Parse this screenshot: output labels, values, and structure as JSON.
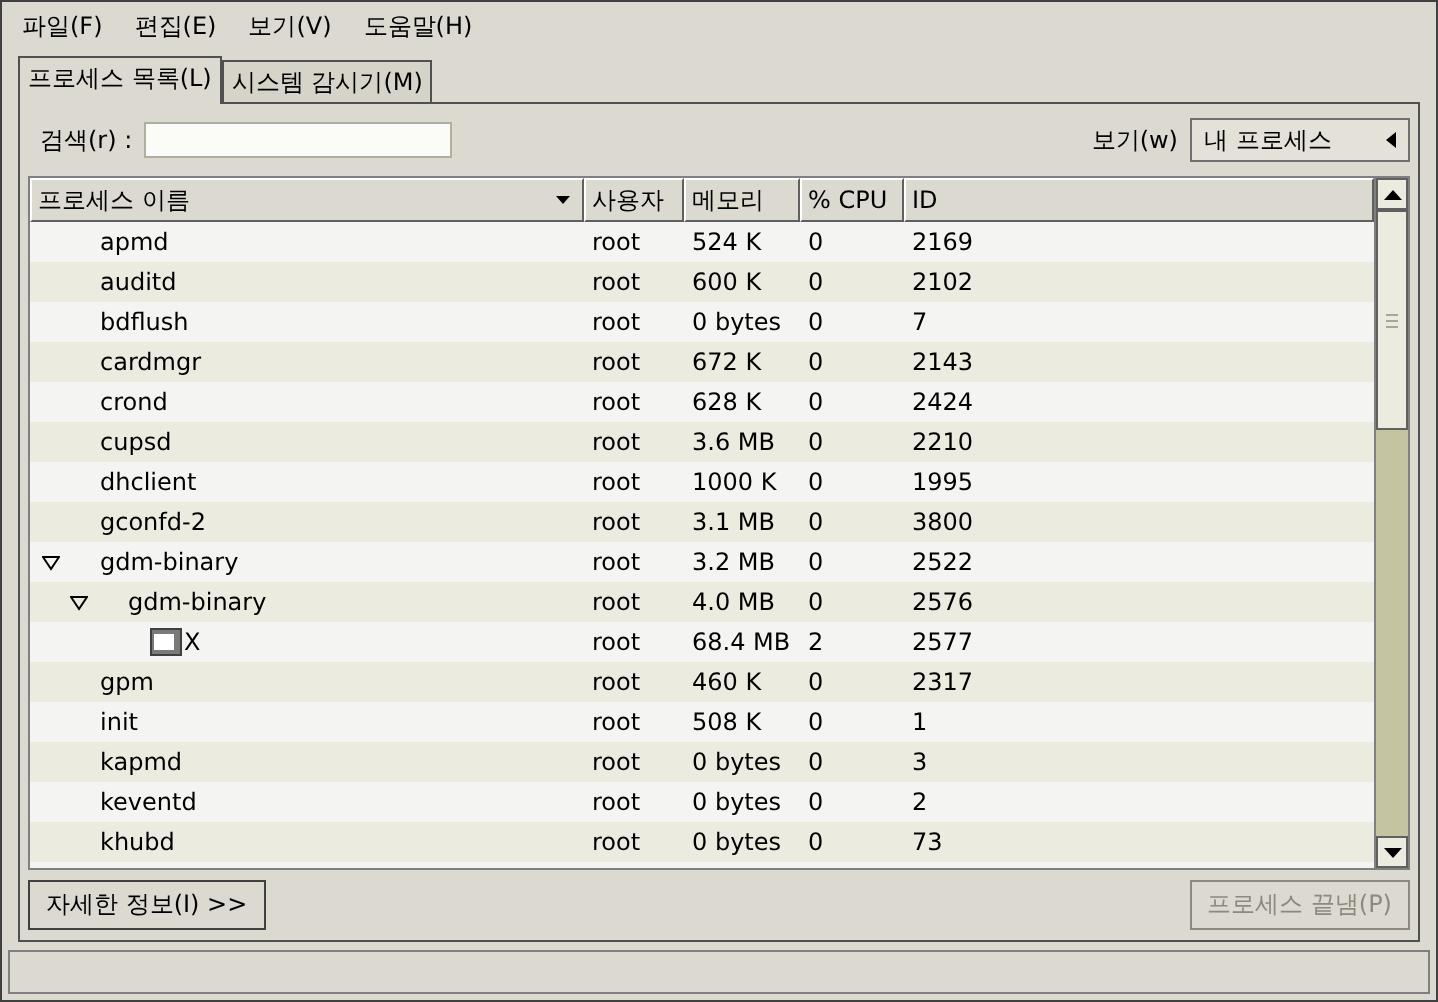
{
  "menu": [
    "파일(F)",
    "편집(E)",
    "보기(V)",
    "도움말(H)"
  ],
  "tabs": [
    {
      "label": "프로세스 목록(L)",
      "selected": true
    },
    {
      "label": "시스템 감시기(M)",
      "selected": false
    }
  ],
  "search": {
    "label": "검색(r) :"
  },
  "view": {
    "label": "보기(w)",
    "value": "내 프로세스"
  },
  "table": {
    "columns": [
      "프로세스 이름",
      "사용자",
      "메모리",
      "% CPU",
      "ID"
    ],
    "rows": [
      {
        "name": "apmd",
        "user": "root",
        "memory": "524 K",
        "cpu": "0",
        "id": "2169"
      },
      {
        "name": "auditd",
        "user": "root",
        "memory": "600 K",
        "cpu": "0",
        "id": "2102"
      },
      {
        "name": "bdflush",
        "user": "root",
        "memory": "0 bytes",
        "cpu": "0",
        "id": "7"
      },
      {
        "name": "cardmgr",
        "user": "root",
        "memory": "672 K",
        "cpu": "0",
        "id": "2143"
      },
      {
        "name": "crond",
        "user": "root",
        "memory": "628 K",
        "cpu": "0",
        "id": "2424"
      },
      {
        "name": "cupsd",
        "user": "root",
        "memory": "3.6 MB",
        "cpu": "0",
        "id": "2210"
      },
      {
        "name": "dhclient",
        "user": "root",
        "memory": "1000 K",
        "cpu": "0",
        "id": "1995"
      },
      {
        "name": "gconfd-2",
        "user": "root",
        "memory": "3.1 MB",
        "cpu": "0",
        "id": "3800"
      },
      {
        "name": "gdm-binary",
        "user": "root",
        "memory": "3.2 MB",
        "cpu": "0",
        "id": "2522",
        "expanded": true,
        "children": [
          {
            "name": "gdm-binary",
            "user": "root",
            "memory": "4.0 MB",
            "cpu": "0",
            "id": "2576",
            "expanded": true,
            "children": [
              {
                "name": "X",
                "user": "root",
                "memory": "68.4 MB",
                "cpu": "2",
                "id": "2577"
              }
            ]
          }
        ]
      },
      {
        "name": "gpm",
        "user": "root",
        "memory": "460 K",
        "cpu": "0",
        "id": "2317"
      },
      {
        "name": "init",
        "user": "root",
        "memory": "508 K",
        "cpu": "0",
        "id": "1"
      },
      {
        "name": "kapmd",
        "user": "root",
        "memory": "0 bytes",
        "cpu": "0",
        "id": "3"
      },
      {
        "name": "keventd",
        "user": "root",
        "memory": "0 bytes",
        "cpu": "0",
        "id": "2"
      },
      {
        "name": "khubd",
        "user": "root",
        "memory": "0 bytes",
        "cpu": "0",
        "id": "73"
      }
    ]
  },
  "buttons": [
    {
      "label": "자세한 정보(I) >>",
      "disabled": false
    },
    {
      "label": "프로세스 끝냄(P)",
      "disabled": true
    }
  ]
}
